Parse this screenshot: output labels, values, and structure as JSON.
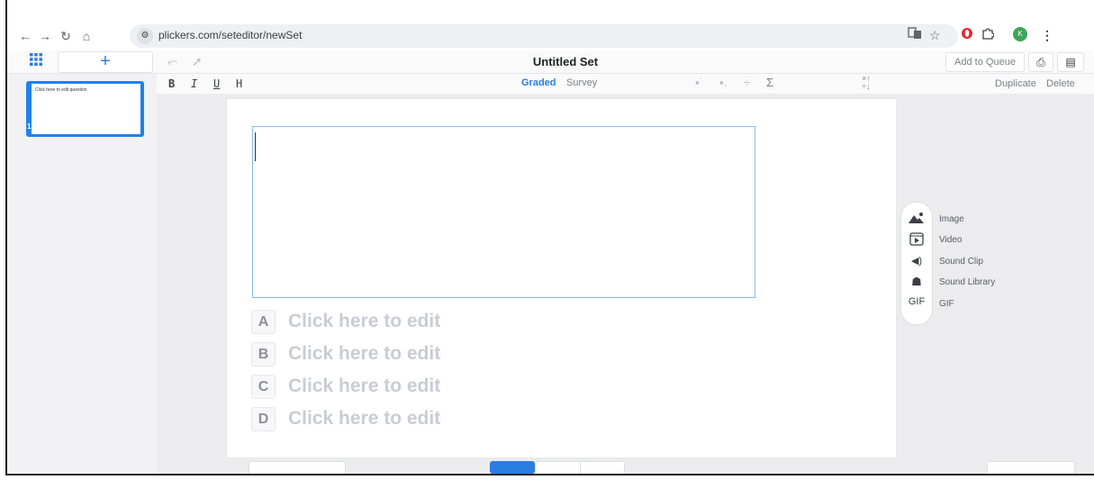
{
  "browser": {
    "url": "plickers.com/seteditor/newSet",
    "nav": [
      "←",
      "→",
      "↻",
      "⌂"
    ],
    "profile_initial": "K"
  },
  "toolbar": {
    "add_label": "+",
    "set_title": "Untitled Set",
    "add_to_queue": "Add to Queue"
  },
  "format": {
    "bold": "B",
    "italic": "I",
    "underline": "U",
    "heading": "H",
    "graded": "Graded",
    "survey": "Survey",
    "sigma": "Σ",
    "duplicate": "Duplicate",
    "delete": "Delete"
  },
  "sidebar": {
    "thumb_text": "Click here to edit question",
    "thumb_number": "1"
  },
  "choices": [
    {
      "letter": "A",
      "text": "Click here to edit"
    },
    {
      "letter": "B",
      "text": "Click here to edit"
    },
    {
      "letter": "C",
      "text": "Click here to edit"
    },
    {
      "letter": "D",
      "text": "Click here to edit"
    }
  ],
  "media": {
    "image": "Image",
    "video": "Video",
    "sound_clip": "Sound Clip",
    "sound_library": "Sound Library",
    "gif": "GIF",
    "gif_icon": "GIF"
  },
  "colors": {
    "accent": "#2a7de1",
    "thumb": "#1f82ea",
    "opera_red": "#e8252b",
    "profile_green": "#3aa757"
  }
}
